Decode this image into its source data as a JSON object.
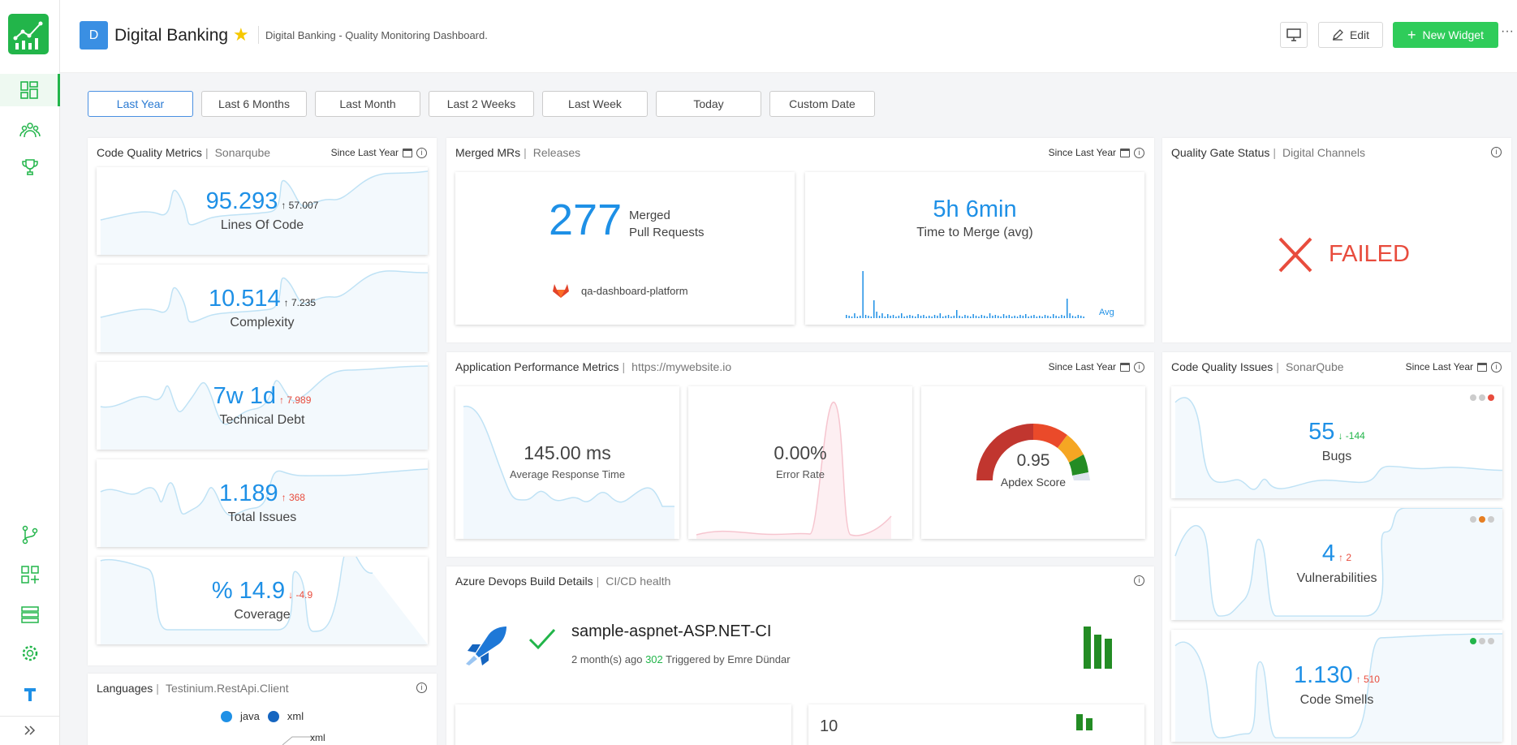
{
  "app": {
    "avatar_letter": "D",
    "title": "Digital Banking",
    "description": "Digital Banking - Quality Monitoring Dashboard."
  },
  "header": {
    "edit_label": "Edit",
    "new_widget_label": "New Widget",
    "more": "···"
  },
  "filters": [
    "Last Year",
    "Last 6 Months",
    "Last Month",
    "Last 2 Weeks",
    "Last Week",
    "Today",
    "Custom Date"
  ],
  "active_filter": "Last Year",
  "code_quality": {
    "title": "Code Quality Metrics",
    "source": "Sonarqube",
    "since": "Since Last Year",
    "metrics": [
      {
        "value": "95.293",
        "delta": "57.007",
        "direction": "up",
        "trend": "neutral",
        "label": "Lines Of Code"
      },
      {
        "value": "10.514",
        "delta": "7.235",
        "direction": "up",
        "trend": "neutral",
        "label": "Complexity"
      },
      {
        "value": "7w 1d",
        "delta": "7.989",
        "direction": "up",
        "trend": "bad",
        "label": "Technical Debt"
      },
      {
        "value": "1.189",
        "delta": "368",
        "direction": "up",
        "trend": "bad",
        "label": "Total Issues"
      },
      {
        "value": "% 14.9",
        "delta": "-4.9",
        "direction": "down",
        "trend": "bad",
        "label": "Coverage"
      }
    ]
  },
  "languages": {
    "title": "Languages",
    "source": "Testinium.RestApi.Client",
    "legend": [
      {
        "name": "java",
        "color": "#1e90e6"
      },
      {
        "name": "xml",
        "color": "#1565c0"
      }
    ],
    "slice_label": "xml"
  },
  "merged": {
    "title": "Merged MRs",
    "source": "Releases",
    "since": "Since Last Year",
    "count": "277",
    "count_label_1": "Merged",
    "count_label_2": "Pull Requests",
    "repo": "qa-dashboard-platform",
    "time": "5h 6min",
    "time_label": "Time to Merge (avg)",
    "avg_label": "Avg"
  },
  "quality_gate": {
    "title": "Quality Gate Status",
    "source": "Digital Channels",
    "status": "FAILED",
    "status_color": "#e84c3d"
  },
  "apm": {
    "title": "Application Performance Metrics",
    "source": "https://mywebsite.io",
    "since": "Since Last Year",
    "response": {
      "value": "145.00 ms",
      "label": "Average Response Time"
    },
    "error": {
      "value": "0.00%",
      "label": "Error Rate"
    },
    "apdex": {
      "value": "0.95",
      "label": "Apdex Score"
    }
  },
  "issues": {
    "title": "Code Quality Issues",
    "source": "SonarQube",
    "since": "Since Last Year",
    "items": [
      {
        "value": "55",
        "delta": "-144",
        "direction": "down",
        "trend": "good",
        "label": "Bugs",
        "active_dot": "#e84c3d"
      },
      {
        "value": "4",
        "delta": "2",
        "direction": "up",
        "trend": "bad",
        "label": "Vulnerabilities",
        "active_dot": "#e67e22"
      },
      {
        "value": "1.130",
        "delta": "510",
        "direction": "up",
        "trend": "bad",
        "label": "Code Smells",
        "active_dot": "#22b54a"
      }
    ]
  },
  "azure": {
    "title": "Azure Devops Build Details",
    "source": "CI/CD health",
    "build_name": "sample-aspnet-ASP.NET-CI",
    "ago": "2 month(s) ago",
    "build_number": "302",
    "triggered": "Triggered by Emre Dündar",
    "partial_number": "10"
  },
  "colors": {
    "accent": "#1e90e6",
    "brand": "#22b54a",
    "danger": "#e84c3d"
  }
}
